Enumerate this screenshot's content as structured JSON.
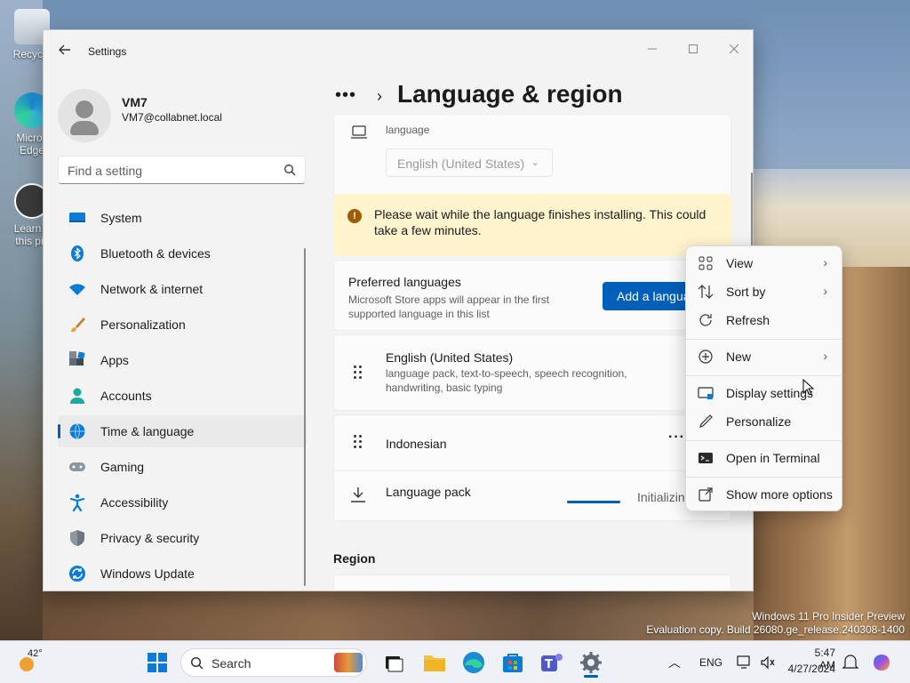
{
  "desktop": {
    "icons": [
      {
        "label": "Recycle"
      },
      {
        "label": "Micros Edge"
      },
      {
        "label": "Learn a this pic"
      }
    ],
    "watermark_line1": "Windows 11 Pro Insider Preview",
    "watermark_line2": "Evaluation copy. Build 26080.ge_release.240308-1400"
  },
  "window": {
    "title": "Settings",
    "minimize_icon": "minimize-icon",
    "maximize_icon": "maximize-icon",
    "close_icon": "close-icon"
  },
  "user": {
    "name": "VM7",
    "email": "VM7@collabnet.local"
  },
  "search": {
    "placeholder": "Find a setting"
  },
  "nav": {
    "items": [
      {
        "label": "System",
        "icon": "monitor-icon",
        "active": false
      },
      {
        "label": "Bluetooth & devices",
        "icon": "bluetooth-icon",
        "active": false
      },
      {
        "label": "Network & internet",
        "icon": "wifi-icon",
        "active": false
      },
      {
        "label": "Personalization",
        "icon": "brush-icon",
        "active": false
      },
      {
        "label": "Apps",
        "icon": "apps-icon",
        "active": false
      },
      {
        "label": "Accounts",
        "icon": "person-icon",
        "active": false
      },
      {
        "label": "Time & language",
        "icon": "globe-clock-icon",
        "active": true
      },
      {
        "label": "Gaming",
        "icon": "gamepad-icon",
        "active": false
      },
      {
        "label": "Accessibility",
        "icon": "accessibility-icon",
        "active": false
      },
      {
        "label": "Privacy & security",
        "icon": "shield-icon",
        "active": false
      },
      {
        "label": "Windows Update",
        "icon": "update-icon",
        "active": false
      }
    ]
  },
  "page": {
    "breadcrumb_more": "•••",
    "breadcrumb_sep": "›",
    "title": "Language & region",
    "display_language": {
      "label": "language",
      "selected": "English (United States)"
    },
    "warning": "Please wait while the language finishes installing. This could take a few minutes.",
    "preferred": {
      "title": "Preferred languages",
      "desc": "Microsoft Store apps will appear in the first supported language in this list",
      "button": "Add a language"
    },
    "languages": [
      {
        "name": "English (United States)",
        "desc": "language pack, text-to-speech, speech recognition, handwriting, basic typing"
      },
      {
        "name": "Indonesian",
        "desc": ""
      }
    ],
    "language_pack": {
      "label": "Language pack",
      "status": "Initializing"
    },
    "region_heading": "Region"
  },
  "context_menu": {
    "items": [
      {
        "label": "View",
        "icon": "grid-icon",
        "submenu": true
      },
      {
        "label": "Sort by",
        "icon": "sort-icon",
        "submenu": true
      },
      {
        "label": "Refresh",
        "icon": "refresh-icon",
        "submenu": false
      },
      {
        "label": "New",
        "icon": "plus-circle-icon",
        "submenu": true
      },
      {
        "label": "Display settings",
        "icon": "display-icon",
        "submenu": false
      },
      {
        "label": "Personalize",
        "icon": "pen-icon",
        "submenu": false
      },
      {
        "label": "Open in Terminal",
        "icon": "terminal-icon",
        "submenu": false
      },
      {
        "label": "Show more options",
        "icon": "external-icon",
        "submenu": false
      }
    ]
  },
  "taskbar": {
    "weather_temp": "42°",
    "search_label": "Search",
    "language": "ENG",
    "time": "5:47 AM",
    "date": "4/27/2024",
    "colors": {
      "accent": "#005fb8",
      "warning_bg": "#fff4ce"
    }
  }
}
